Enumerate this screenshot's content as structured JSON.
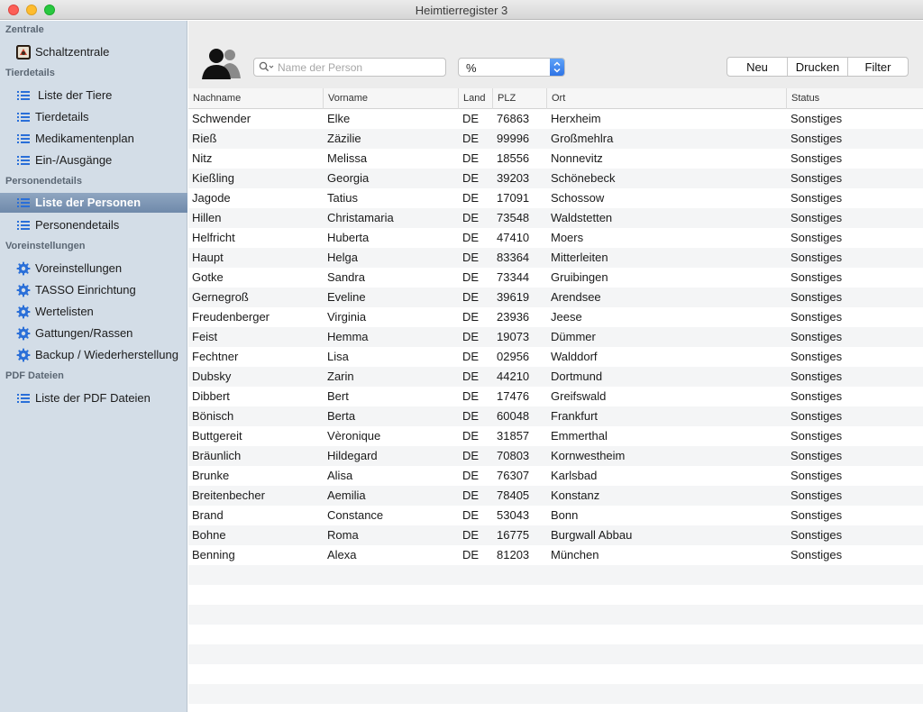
{
  "window": {
    "title": "Heimtierregister 3"
  },
  "sidebar": {
    "sections": [
      "Zentrale",
      "Tierdetails",
      "Personendetails",
      "Voreinstellungen",
      "PDF Dateien"
    ],
    "items": [
      {
        "label": "Schaltzentrale",
        "icon": "app-icon"
      },
      {
        "label": "Liste der Tiere",
        "icon": "list-icon"
      },
      {
        "label": "Tierdetails",
        "icon": "list-icon"
      },
      {
        "label": "Medikamentenplan",
        "icon": "list-icon"
      },
      {
        "label": "Ein-/Ausgänge",
        "icon": "list-icon"
      },
      {
        "label": "Liste der Personen",
        "icon": "list-icon",
        "selected": true
      },
      {
        "label": "Personendetails",
        "icon": "list-icon"
      },
      {
        "label": "Voreinstellungen",
        "icon": "gear-icon"
      },
      {
        "label": "TASSO Einrichtung",
        "icon": "gear-icon"
      },
      {
        "label": "Wertelisten",
        "icon": "gear-icon"
      },
      {
        "label": "Gattungen/Rassen",
        "icon": "gear-icon"
      },
      {
        "label": "Backup / Wiederherstellung",
        "icon": "gear-icon"
      },
      {
        "label": "Liste der PDF Dateien",
        "icon": "list-icon"
      }
    ]
  },
  "toolbar": {
    "search_placeholder": "Name der Person",
    "search_value": "",
    "filter_select_value": "%",
    "buttons": {
      "new": "Neu",
      "print": "Drucken",
      "filter": "Filter"
    }
  },
  "table": {
    "columns": [
      "Nachname",
      "Vorname",
      "Land",
      "PLZ",
      "Ort",
      "Status"
    ],
    "rows": [
      [
        "Schwender",
        "Elke",
        "DE",
        "76863",
        "Herxheim",
        "Sonstiges"
      ],
      [
        "Rieß",
        "Zäzilie",
        "DE",
        "99996",
        "Großmehlra",
        "Sonstiges"
      ],
      [
        "Nitz",
        "Melissa",
        "DE",
        "18556",
        "Nonnevitz",
        "Sonstiges"
      ],
      [
        "Kießling",
        "Georgia",
        "DE",
        "39203",
        "Schönebeck",
        "Sonstiges"
      ],
      [
        "Jagode",
        "Tatius",
        "DE",
        "17091",
        "Schossow",
        "Sonstiges"
      ],
      [
        "Hillen",
        "Christamaria",
        "DE",
        "73548",
        "Waldstetten",
        "Sonstiges"
      ],
      [
        "Helfricht",
        "Huberta",
        "DE",
        "47410",
        "Moers",
        "Sonstiges"
      ],
      [
        "Haupt",
        "Helga",
        "DE",
        "83364",
        "Mitterleiten",
        "Sonstiges"
      ],
      [
        "Gotke",
        "Sandra",
        "DE",
        "73344",
        "Gruibingen",
        "Sonstiges"
      ],
      [
        "Gernegroß",
        "Eveline",
        "DE",
        "39619",
        "Arendsee",
        "Sonstiges"
      ],
      [
        "Freudenberger",
        "Virginia",
        "DE",
        "23936",
        "Jeese",
        "Sonstiges"
      ],
      [
        "Feist",
        "Hemma",
        "DE",
        "19073",
        "Dümmer",
        "Sonstiges"
      ],
      [
        "Fechtner",
        "Lisa",
        "DE",
        "02956",
        "Walddorf",
        "Sonstiges"
      ],
      [
        "Dubsky",
        "Zarin",
        "DE",
        "44210",
        "Dortmund",
        "Sonstiges"
      ],
      [
        "Dibbert",
        "Bert",
        "DE",
        "17476",
        "Greifswald",
        "Sonstiges"
      ],
      [
        "Bönisch",
        "Berta",
        "DE",
        "60048",
        "Frankfurt",
        "Sonstiges"
      ],
      [
        "Buttgereit",
        "Vèronique",
        "DE",
        "31857",
        "Emmerthal",
        "Sonstiges"
      ],
      [
        "Bräunlich",
        "Hildegard",
        "DE",
        "70803",
        "Kornwestheim",
        "Sonstiges"
      ],
      [
        "Brunke",
        "Alisa",
        "DE",
        "76307",
        "Karlsbad",
        "Sonstiges"
      ],
      [
        "Breitenbecher",
        "Aemilia",
        "DE",
        "78405",
        "Konstanz",
        "Sonstiges"
      ],
      [
        "Brand",
        "Constance",
        "DE",
        "53043",
        "Bonn",
        "Sonstiges"
      ],
      [
        "Bohne",
        "Roma",
        "DE",
        "16775",
        "Burgwall Abbau",
        "Sonstiges"
      ],
      [
        "Benning",
        "Alexa",
        "DE",
        "81203",
        "München",
        "Sonstiges"
      ]
    ]
  },
  "colors": {
    "sidebar_bg": "#d3dde7",
    "selection": "#7d95b4",
    "accent_icon": "#2a6fd8",
    "select_accent": "#2f74e6"
  }
}
